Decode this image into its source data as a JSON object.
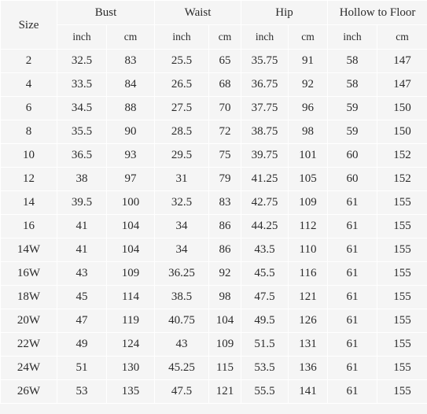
{
  "table": {
    "header": {
      "size_label": "Size",
      "groups": [
        {
          "label": "Bust"
        },
        {
          "label": "Waist"
        },
        {
          "label": "Hip"
        },
        {
          "label": "Hollow to Floor"
        }
      ],
      "units": [
        "inch",
        "cm",
        "inch",
        "cm",
        "inch",
        "cm",
        "inch",
        "cm"
      ]
    },
    "rows": [
      {
        "size": "2",
        "bust_in": "32.5",
        "bust_cm": "83",
        "waist_in": "25.5",
        "waist_cm": "65",
        "hip_in": "35.75",
        "hip_cm": "91",
        "hf_in": "58",
        "hf_cm": "147"
      },
      {
        "size": "4",
        "bust_in": "33.5",
        "bust_cm": "84",
        "waist_in": "26.5",
        "waist_cm": "68",
        "hip_in": "36.75",
        "hip_cm": "92",
        "hf_in": "58",
        "hf_cm": "147"
      },
      {
        "size": "6",
        "bust_in": "34.5",
        "bust_cm": "88",
        "waist_in": "27.5",
        "waist_cm": "70",
        "hip_in": "37.75",
        "hip_cm": "96",
        "hf_in": "59",
        "hf_cm": "150"
      },
      {
        "size": "8",
        "bust_in": "35.5",
        "bust_cm": "90",
        "waist_in": "28.5",
        "waist_cm": "72",
        "hip_in": "38.75",
        "hip_cm": "98",
        "hf_in": "59",
        "hf_cm": "150"
      },
      {
        "size": "10",
        "bust_in": "36.5",
        "bust_cm": "93",
        "waist_in": "29.5",
        "waist_cm": "75",
        "hip_in": "39.75",
        "hip_cm": "101",
        "hf_in": "60",
        "hf_cm": "152"
      },
      {
        "size": "12",
        "bust_in": "38",
        "bust_cm": "97",
        "waist_in": "31",
        "waist_cm": "79",
        "hip_in": "41.25",
        "hip_cm": "105",
        "hf_in": "60",
        "hf_cm": "152"
      },
      {
        "size": "14",
        "bust_in": "39.5",
        "bust_cm": "100",
        "waist_in": "32.5",
        "waist_cm": "83",
        "hip_in": "42.75",
        "hip_cm": "109",
        "hf_in": "61",
        "hf_cm": "155"
      },
      {
        "size": "16",
        "bust_in": "41",
        "bust_cm": "104",
        "waist_in": "34",
        "waist_cm": "86",
        "hip_in": "44.25",
        "hip_cm": "112",
        "hf_in": "61",
        "hf_cm": "155"
      },
      {
        "size": "14W",
        "bust_in": "41",
        "bust_cm": "104",
        "waist_in": "34",
        "waist_cm": "86",
        "hip_in": "43.5",
        "hip_cm": "110",
        "hf_in": "61",
        "hf_cm": "155"
      },
      {
        "size": "16W",
        "bust_in": "43",
        "bust_cm": "109",
        "waist_in": "36.25",
        "waist_cm": "92",
        "hip_in": "45.5",
        "hip_cm": "116",
        "hf_in": "61",
        "hf_cm": "155"
      },
      {
        "size": "18W",
        "bust_in": "45",
        "bust_cm": "114",
        "waist_in": "38.5",
        "waist_cm": "98",
        "hip_in": "47.5",
        "hip_cm": "121",
        "hf_in": "61",
        "hf_cm": "155"
      },
      {
        "size": "20W",
        "bust_in": "47",
        "bust_cm": "119",
        "waist_in": "40.75",
        "waist_cm": "104",
        "hip_in": "49.5",
        "hip_cm": "126",
        "hf_in": "61",
        "hf_cm": "155"
      },
      {
        "size": "22W",
        "bust_in": "49",
        "bust_cm": "124",
        "waist_in": "43",
        "waist_cm": "109",
        "hip_in": "51.5",
        "hip_cm": "131",
        "hf_in": "61",
        "hf_cm": "155"
      },
      {
        "size": "24W",
        "bust_in": "51",
        "bust_cm": "130",
        "waist_in": "45.25",
        "waist_cm": "115",
        "hip_in": "53.5",
        "hip_cm": "136",
        "hf_in": "61",
        "hf_cm": "155"
      },
      {
        "size": "26W",
        "bust_in": "53",
        "bust_cm": "135",
        "waist_in": "47.5",
        "waist_cm": "121",
        "hip_in": "55.5",
        "hip_cm": "141",
        "hf_in": "61",
        "hf_cm": "155"
      }
    ]
  },
  "colors": {
    "background": "#f5f5f5",
    "gridline": "#ffffff",
    "text": "#2b2b2b"
  }
}
